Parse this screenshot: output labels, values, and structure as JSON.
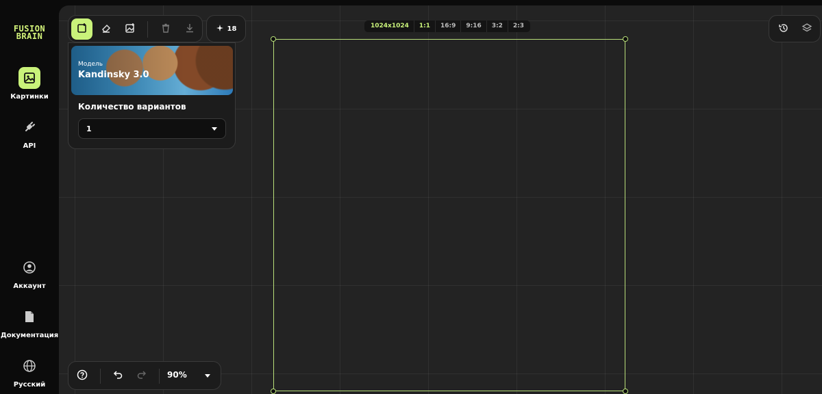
{
  "logo": {
    "line1": "FUSION",
    "line2": "BRAIN"
  },
  "sidebar": {
    "items": [
      {
        "label": "Картинки",
        "icon": "image-icon",
        "active": true
      },
      {
        "label": "API",
        "icon": "plug-icon",
        "active": false
      },
      {
        "label": "Аккаунт",
        "icon": "account-icon",
        "active": false
      },
      {
        "label": "Документация",
        "icon": "document-icon",
        "active": false
      },
      {
        "label": "Русский",
        "icon": "globe-icon",
        "active": false
      }
    ]
  },
  "toolbar": {
    "tools": [
      "add-image-icon",
      "eraser-icon",
      "image-edit-icon",
      "trash-icon",
      "download-icon"
    ],
    "credits": "18"
  },
  "settings": {
    "model_label": "Модель",
    "model_name": "Kandinsky 3.0",
    "variants_label": "Количество вариантов",
    "variants_value": "1"
  },
  "ratios": {
    "items": [
      "1024x1024",
      "1:1",
      "16:9",
      "9:16",
      "3:2",
      "2:3"
    ],
    "active": [
      "1024x1024",
      "1:1"
    ]
  },
  "right_tools": [
    "history-icon",
    "layers-icon"
  ],
  "bottombar": {
    "zoom": "90%"
  },
  "colors": {
    "accent": "#c9f27a",
    "canvas": "#232323",
    "sidebar": "#0b0b0b",
    "frame": "#b9e07a"
  }
}
